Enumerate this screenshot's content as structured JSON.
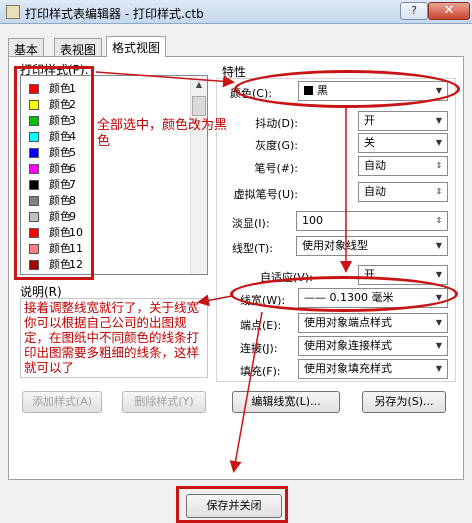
{
  "window": {
    "title": "打印样式表编辑器 - 打印样式.ctb",
    "help": "?",
    "close": "✕"
  },
  "tabs": [
    {
      "label": "基本"
    },
    {
      "label": "表视图"
    },
    {
      "label": "格式视图"
    }
  ],
  "print_styles": {
    "label": "打印样式(P):",
    "items": [
      {
        "name": "颜色",
        "num": "1",
        "color": "#ff0000"
      },
      {
        "name": "颜色",
        "num": "2",
        "color": "#ffff00"
      },
      {
        "name": "颜色",
        "num": "3",
        "color": "#00c000"
      },
      {
        "name": "颜色",
        "num": "4",
        "color": "#00ffff"
      },
      {
        "name": "颜色",
        "num": "5",
        "color": "#0000ff"
      },
      {
        "name": "颜色",
        "num": "6",
        "color": "#ff00ff"
      },
      {
        "name": "颜色",
        "num": "7",
        "color": "#000000"
      },
      {
        "name": "颜色",
        "num": "8",
        "color": "#808080"
      },
      {
        "name": "颜色",
        "num": "9",
        "color": "#c0c0c0"
      },
      {
        "name": "颜色",
        "num": "10",
        "color": "#ff0000"
      },
      {
        "name": "颜色",
        "num": "11",
        "color": "#ff7f7f"
      },
      {
        "name": "颜色",
        "num": "12",
        "color": "#a50000"
      }
    ]
  },
  "description": {
    "label": "说明(R)"
  },
  "buttons": {
    "add_style": "添加样式(A)",
    "delete_style": "删除样式(Y)",
    "edit_lineweight": "编辑线宽(L)...",
    "save_as": "另存为(S)...",
    "save_close": "保存并关闭"
  },
  "properties": {
    "title": "特性",
    "color": {
      "label": "颜色(C):",
      "value": "黑"
    },
    "dither": {
      "label": "抖动(D):",
      "value": "开"
    },
    "grayscale": {
      "label": "灰度(G):",
      "value": "关"
    },
    "pen": {
      "label": "笔号(#):",
      "value": "自动"
    },
    "virtual_pen": {
      "label": "虚拟笔号(U):",
      "value": "自动"
    },
    "screening": {
      "label": "淡显(I):",
      "value": "100"
    },
    "linetype": {
      "label": "线型(T):",
      "value": "使用对象线型"
    },
    "adaptive": {
      "label": "自适应(V):",
      "value": "开"
    },
    "lineweight": {
      "label": "线宽(W):",
      "value": "—— 0.1300 毫米"
    },
    "line_end": {
      "label": "端点(E):",
      "value": "使用对象端点样式"
    },
    "line_join": {
      "label": "连接(J):",
      "value": "使用对象连接样式"
    },
    "fill": {
      "label": "填充(F):",
      "value": "使用对象填充样式"
    }
  },
  "annotations": {
    "note1": "全部选中，颜色改为黑色",
    "note2": "接着调整线宽就行了，关于线宽你可以根据自己公司的出图规定，在图纸中不同颜色的线条打印出图需要多粗细的线条，这样就可以了"
  },
  "colors": {
    "annotation": "#c81414",
    "panel": "#ffffff",
    "dialog": "#f0f0f0"
  }
}
